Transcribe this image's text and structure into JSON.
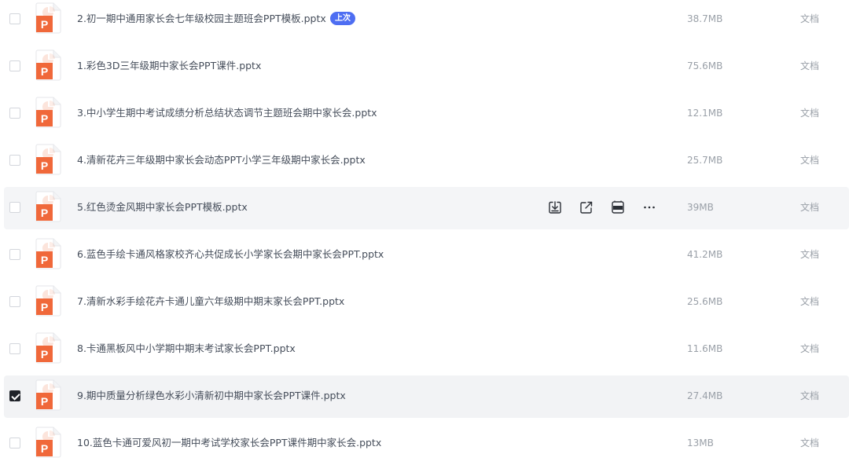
{
  "colors": {
    "ppt_icon": "#f0683a",
    "badge": "#4e6ef2",
    "hover_row": "#f4f5f7",
    "checked_box": "#1f2329"
  },
  "files": [
    {
      "name": "2.初一期中通用家长会七年级校园主题班会PPT模板.pptx",
      "size": "38.7MB",
      "type": "文档",
      "badge": "上次",
      "checked": false
    },
    {
      "name": "1.彩色3D三年级期中家长会PPT课件.pptx",
      "size": "75.6MB",
      "type": "文档",
      "checked": false
    },
    {
      "name": "3.中小学生期中考试成绩分析总结状态调节主题班会期中家长会.pptx",
      "size": "12.1MB",
      "type": "文档",
      "checked": false
    },
    {
      "name": "4.清新花卉三年级期中家长会动态PPT小学三年级期中家长会.pptx",
      "size": "25.7MB",
      "type": "文档",
      "checked": false
    },
    {
      "name": "5.红色烫金风期中家长会PPT模板.pptx",
      "size": "39MB",
      "type": "文档",
      "checked": false,
      "hover": true
    },
    {
      "name": "6.蓝色手绘卡通风格家校齐心共促成长小学家长会期中家长会PPT.pptx",
      "size": "41.2MB",
      "type": "文档",
      "checked": false
    },
    {
      "name": "7.清新水彩手绘花卉卡通儿童六年级期中期末家长会PPT.pptx",
      "size": "25.6MB",
      "type": "文档",
      "checked": false
    },
    {
      "name": "8.卡通黑板风中小学期中期末考试家长会PPT.pptx",
      "size": "11.6MB",
      "type": "文档",
      "checked": false
    },
    {
      "name": "9.期中质量分析绿色水彩小清新初中期中家长会PPT课件.pptx",
      "size": "27.4MB",
      "type": "文档",
      "checked": true
    },
    {
      "name": "10.蓝色卡通可爱风初一期中考试学校家长会PPT课件期中家长会.pptx",
      "size": "13MB",
      "type": "文档",
      "checked": false
    }
  ],
  "hover_actions": [
    {
      "icon": "download-icon"
    },
    {
      "icon": "share-icon"
    },
    {
      "icon": "pdf-icon"
    },
    {
      "icon": "more-icon"
    }
  ]
}
